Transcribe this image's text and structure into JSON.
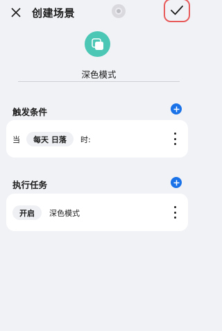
{
  "header": {
    "title": "创建场景"
  },
  "scene": {
    "name": "深色模式",
    "icon_color": "#4cc7b6"
  },
  "trigger_section": {
    "title": "触发条件",
    "row": {
      "prefix": "当",
      "chip": "每天 日落",
      "suffix": "时:"
    }
  },
  "task_section": {
    "title": "执行任务",
    "row": {
      "chip": "开启",
      "label": "深色模式"
    }
  },
  "colors": {
    "accent": "#1a72e8",
    "confirm_highlight": "#e85a5a",
    "background": "#f1f2f6"
  }
}
